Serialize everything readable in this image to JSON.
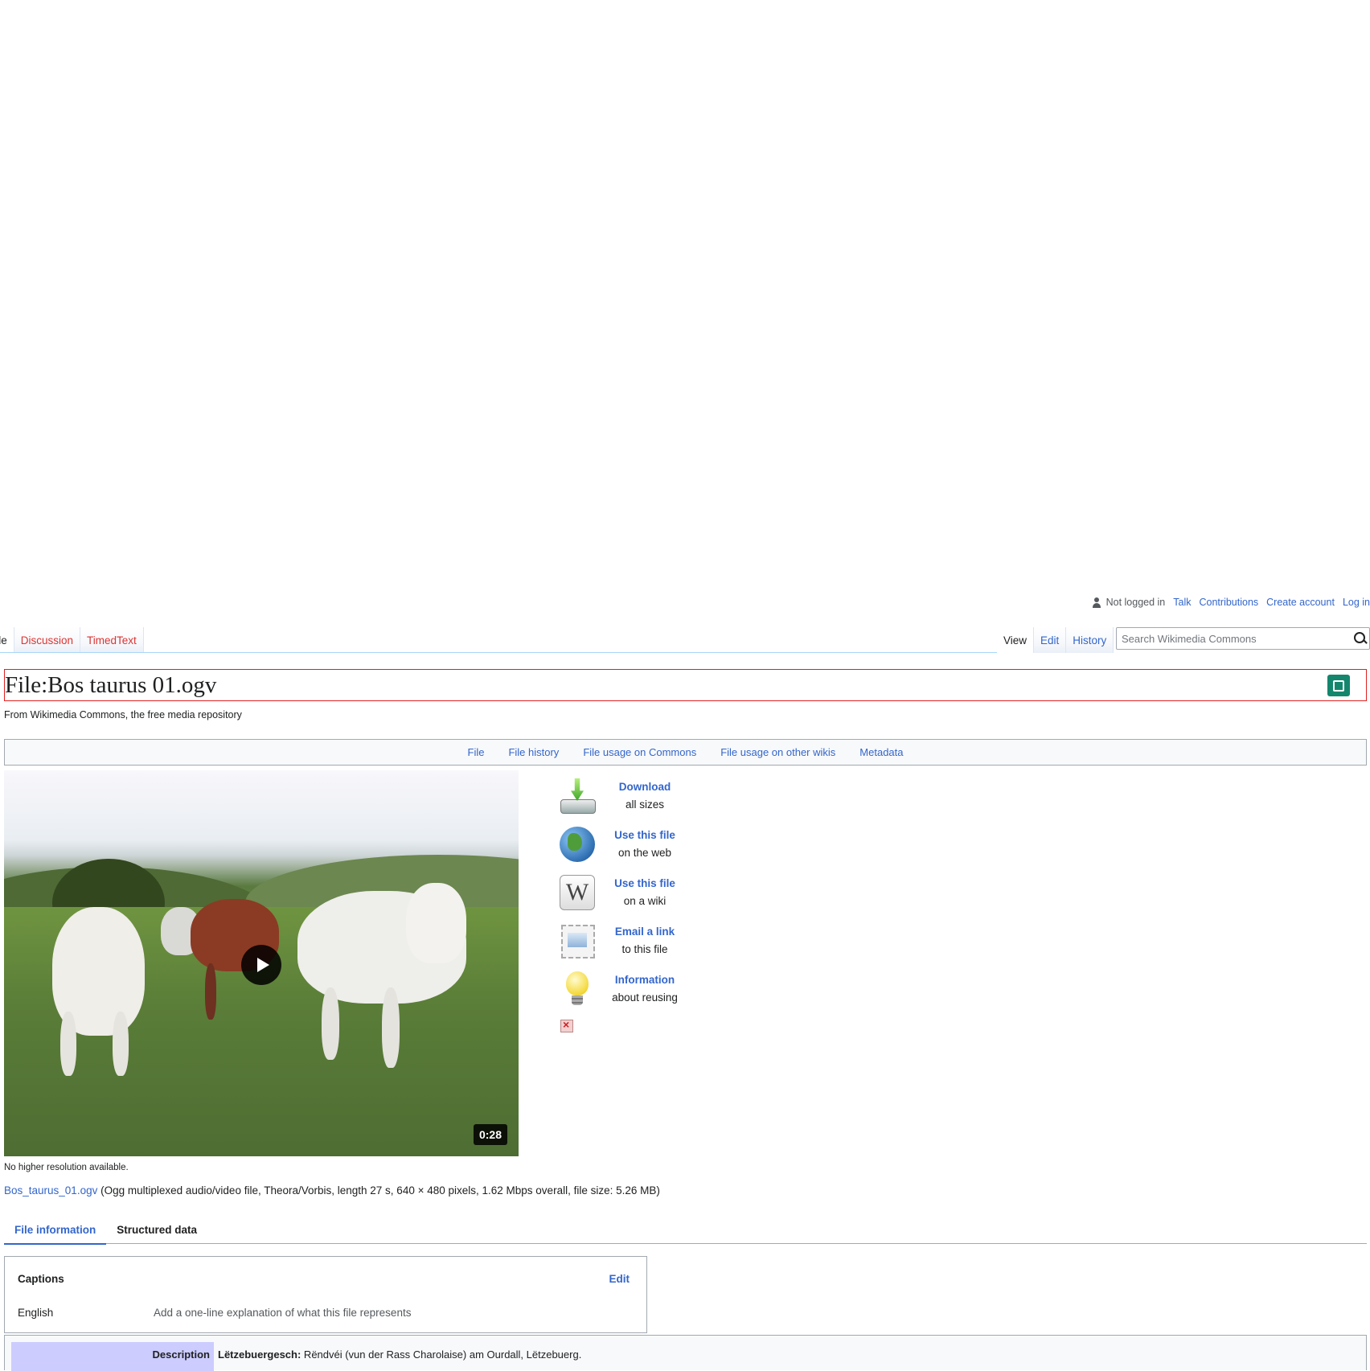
{
  "personal": {
    "status": "Not logged in",
    "links": [
      "Talk",
      "Contributions",
      "Create account",
      "Log in"
    ]
  },
  "namespace_tabs": [
    {
      "label": "File",
      "selected": true
    },
    {
      "label": "Discussion"
    },
    {
      "label": "TimedText"
    }
  ],
  "view_tabs": [
    {
      "label": "View",
      "selected": true
    },
    {
      "label": "Edit"
    },
    {
      "label": "History"
    }
  ],
  "search": {
    "placeholder": "Search Wikimedia Commons"
  },
  "page": {
    "title": "File:Bos taurus 01.ogv",
    "site_sub": "From Wikimedia Commons, the free media repository"
  },
  "file_nav": [
    "File",
    "File history",
    "File usage on Commons",
    "File usage on other wikis",
    "Metadata"
  ],
  "video": {
    "duration": "0:28"
  },
  "actions": [
    {
      "icon": "download-icon",
      "title": "Download",
      "subtitle": "all sizes"
    },
    {
      "icon": "globe-icon",
      "title": "Use this file",
      "subtitle": "on the web"
    },
    {
      "icon": "wikipedia-icon",
      "title": "Use this file",
      "subtitle": "on a wiki"
    },
    {
      "icon": "email-icon",
      "title": "Email a link",
      "subtitle": "to this file"
    },
    {
      "icon": "lightbulb-icon",
      "title": "Information",
      "subtitle": "about reusing"
    }
  ],
  "file_info": {
    "no_higher": "No higher resolution available.",
    "filename": "Bos_taurus_01.ogv",
    "details": " (Ogg multiplexed audio/video file, Theora/Vorbis, length 27 s, 640 × 480 pixels, 1.62 Mbps overall, file size: 5.26 MB)"
  },
  "info_tabs": [
    {
      "label": "File information",
      "active": true
    },
    {
      "label": "Structured data"
    }
  ],
  "captions": {
    "title": "Captions",
    "edit": "Edit",
    "language": "English",
    "placeholder": "Add a one-line explanation of what this file represents"
  },
  "description": {
    "label": "Description",
    "language": "Lëtzebuergesch:",
    "text": " Rëndvéi (vun der Rass Charolaise) am Ourdall, Lëtzebuerg."
  },
  "colors": {
    "link": "#3366cc",
    "redlink": "#d33",
    "heading_border": "#e02020",
    "edit_button": "#14866d",
    "desc_label_bg": "#ccccff"
  }
}
